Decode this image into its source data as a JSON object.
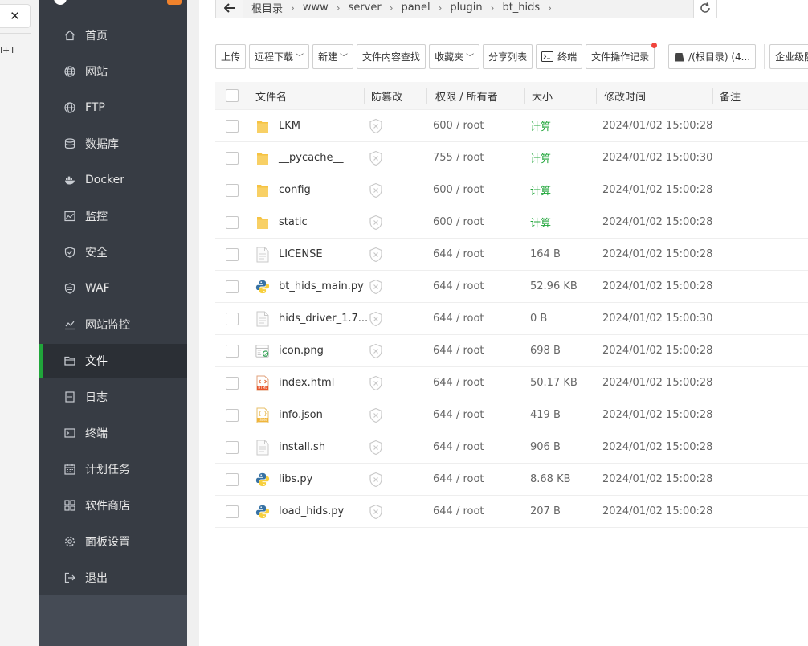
{
  "browser": {
    "close_glyph": "✕",
    "shortcut_text": "l+T"
  },
  "sidebar": {
    "items": [
      {
        "label": "首页",
        "icon": "home-icon"
      },
      {
        "label": "网站",
        "icon": "globe-icon"
      },
      {
        "label": "FTP",
        "icon": "ftp-globe-icon"
      },
      {
        "label": "数据库",
        "icon": "database-icon"
      },
      {
        "label": "Docker",
        "icon": "docker-icon"
      },
      {
        "label": "监控",
        "icon": "monitor-icon"
      },
      {
        "label": "安全",
        "icon": "shield-icon"
      },
      {
        "label": "WAF",
        "icon": "waf-icon"
      },
      {
        "label": "网站监控",
        "icon": "chart-icon"
      },
      {
        "label": "文件",
        "icon": "folder-icon",
        "active": true
      },
      {
        "label": "日志",
        "icon": "log-icon"
      },
      {
        "label": "终端",
        "icon": "terminal-icon"
      },
      {
        "label": "计划任务",
        "icon": "calendar-icon"
      },
      {
        "label": "软件商店",
        "icon": "grid-icon"
      },
      {
        "label": "面板设置",
        "icon": "gear-icon"
      },
      {
        "label": "退出",
        "icon": "logout-icon"
      }
    ]
  },
  "path": {
    "crumbs": [
      "根目录",
      "www",
      "server",
      "panel",
      "plugin",
      "bt_hids"
    ]
  },
  "toolbar": {
    "upload": "上传",
    "remote_download": "远程下载",
    "new": "新建",
    "search_content": "文件内容查找",
    "favorites": "收藏夹",
    "share_list": "分享列表",
    "terminal": "终端",
    "op_log": "文件操作记录",
    "disk": "/(根目录) (4...",
    "enterprise": "企业级防篡"
  },
  "table": {
    "headers": {
      "name": "文件名",
      "guard": "防篡改",
      "perm": "权限 / 所有者",
      "size": "大小",
      "time": "修改时间",
      "note": "备注"
    },
    "rows": [
      {
        "name": "LKM",
        "type": "folder",
        "perm": "600 / root",
        "size": "计算",
        "time": "2024/01/02 15:00:28"
      },
      {
        "name": "__pycache__",
        "type": "folder",
        "perm": "755 / root",
        "size": "计算",
        "time": "2024/01/02 15:00:30"
      },
      {
        "name": "config",
        "type": "folder",
        "perm": "600 / root",
        "size": "计算",
        "time": "2024/01/02 15:00:28"
      },
      {
        "name": "static",
        "type": "folder",
        "perm": "600 / root",
        "size": "计算",
        "time": "2024/01/02 15:00:28"
      },
      {
        "name": "LICENSE",
        "type": "file",
        "perm": "644 / root",
        "size": "164 B",
        "time": "2024/01/02 15:00:28"
      },
      {
        "name": "bt_hids_main.py",
        "type": "python",
        "perm": "644 / root",
        "size": "52.96 KB",
        "time": "2024/01/02 15:00:28"
      },
      {
        "name": "hids_driver_1.7...",
        "type": "file",
        "perm": "644 / root",
        "size": "0 B",
        "time": "2024/01/02 15:00:30"
      },
      {
        "name": "icon.png",
        "type": "image",
        "perm": "644 / root",
        "size": "698 B",
        "time": "2024/01/02 15:00:28"
      },
      {
        "name": "index.html",
        "type": "html",
        "perm": "644 / root",
        "size": "50.17 KB",
        "time": "2024/01/02 15:00:28"
      },
      {
        "name": "info.json",
        "type": "json",
        "perm": "644 / root",
        "size": "419 B",
        "time": "2024/01/02 15:00:28"
      },
      {
        "name": "install.sh",
        "type": "file",
        "perm": "644 / root",
        "size": "906 B",
        "time": "2024/01/02 15:00:28"
      },
      {
        "name": "libs.py",
        "type": "python",
        "perm": "644 / root",
        "size": "8.68 KB",
        "time": "2024/01/02 15:00:28"
      },
      {
        "name": "load_hids.py",
        "type": "python",
        "perm": "644 / root",
        "size": "207 B",
        "time": "2024/01/02 15:00:28"
      }
    ]
  },
  "colors": {
    "sidebar_bg": "#373c44",
    "active_accent": "#20a53a",
    "calc_green": "#20a53a",
    "folder_yellow": "#f6c343"
  }
}
